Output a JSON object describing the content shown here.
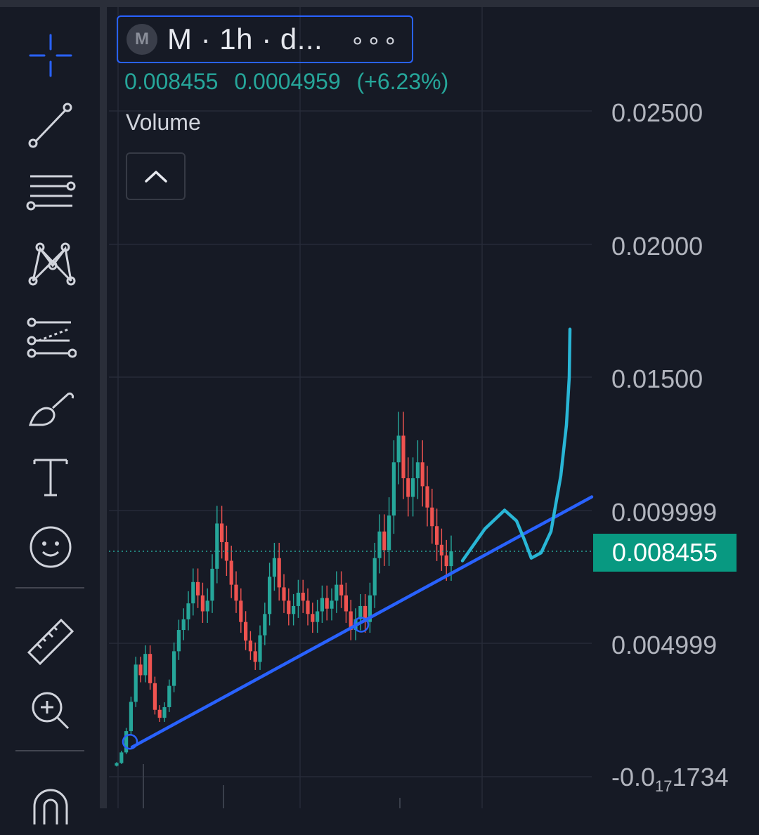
{
  "legend": {
    "symbol_logo": "M",
    "symbol_title": "M · 1h · d...",
    "more_label": "∘∘∘",
    "close_value": "0.008455",
    "change_value": "0.0004959",
    "change_percent": "(+6.23%)",
    "indicator_label": "Volume"
  },
  "price_axis": {
    "labels": [
      "0.02500",
      "0.02000",
      "0.01500",
      "0.009999",
      "0.004999"
    ],
    "bottom_label_main": "-0.0",
    "bottom_label_sub": "17",
    "bottom_label_tail": "1734",
    "last_price": "0.008455"
  },
  "toolbar": {
    "tools": [
      "crosshair-icon",
      "trend-line-icon",
      "fib-retracement-icon",
      "pattern-icon",
      "prediction-icon",
      "brush-icon",
      "text-icon",
      "emoji-icon",
      "ruler-icon",
      "zoom-in-icon",
      "magnet-icon"
    ]
  },
  "colors": {
    "background": "#161a25",
    "up": "#26a69a",
    "down": "#ef5350",
    "trendline": "#2962ff",
    "drawing": "#29b6d6",
    "last_price_bg": "#089981"
  },
  "chart_data": {
    "type": "candlestick",
    "title": "",
    "interval": "1h",
    "ylim": [
      -3e-05,
      0.026
    ],
    "grid": true,
    "last_price": 0.008455,
    "change": 0.0004959,
    "change_percent": 6.23,
    "close_series": [
      0.0005,
      0.0009,
      0.0017,
      0.0028,
      0.0042,
      0.0038,
      0.0046,
      0.0035,
      0.0025,
      0.0022,
      0.0026,
      0.0034,
      0.0047,
      0.0055,
      0.0059,
      0.0065,
      0.0073,
      0.0068,
      0.0062,
      0.0066,
      0.0078,
      0.0095,
      0.0088,
      0.0081,
      0.0072,
      0.0066,
      0.0058,
      0.0051,
      0.0047,
      0.0043,
      0.0053,
      0.0061,
      0.0075,
      0.0082,
      0.0071,
      0.0066,
      0.0061,
      0.0064,
      0.0069,
      0.0066,
      0.0061,
      0.0058,
      0.0062,
      0.0067,
      0.0063,
      0.0066,
      0.0072,
      0.0068,
      0.0062,
      0.0055,
      0.0059,
      0.0064,
      0.0058,
      0.0068,
      0.0082,
      0.0092,
      0.0085,
      0.0098,
      0.0118,
      0.0128,
      0.0112,
      0.0105,
      0.0112,
      0.0118,
      0.0109,
      0.0101,
      0.0094,
      0.0087,
      0.0083,
      0.0079,
      0.008455
    ],
    "trendline": {
      "start_price": 0.0011,
      "end_price": 0.0105,
      "touch_points": [
        0.0013,
        0.0057
      ]
    },
    "projection_sketch": [
      0.0081,
      0.0093,
      0.01,
      0.0096,
      0.0089,
      0.0082,
      0.0084,
      0.0092,
      0.0113,
      0.0132,
      0.015,
      0.0168
    ]
  }
}
